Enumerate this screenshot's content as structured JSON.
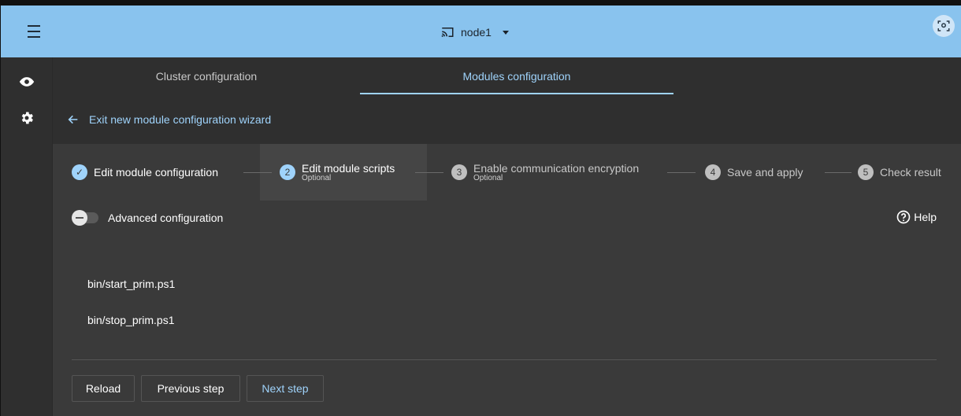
{
  "header": {
    "node_label": "node1",
    "accent_color": "#89c3ee"
  },
  "icons": {
    "menu": "hamburger-menu-icon",
    "cast": "cast-icon",
    "face": "face-scan-icon",
    "eye": "eye-icon",
    "gear": "gear-icon",
    "back": "arrow-left-icon",
    "help": "question-circle-icon"
  },
  "tabs": [
    {
      "label": "Cluster configuration",
      "active": false
    },
    {
      "label": "Modules configuration",
      "active": true
    }
  ],
  "exit_wizard_label": "Exit new module configuration wizard",
  "steps": [
    {
      "number": "✓",
      "label": "Edit module configuration",
      "sub": "",
      "state": "done"
    },
    {
      "number": "2",
      "label": "Edit module scripts",
      "sub": "Optional",
      "state": "active"
    },
    {
      "number": "3",
      "label": "Enable communication encryption",
      "sub": "Optional",
      "state": "todo"
    },
    {
      "number": "4",
      "label": "Save and apply",
      "sub": "",
      "state": "todo"
    },
    {
      "number": "5",
      "label": "Check result",
      "sub": "",
      "state": "todo"
    }
  ],
  "advanced": {
    "label": "Advanced configuration",
    "enabled": false
  },
  "help_label": "Help",
  "scripts": [
    "bin/start_prim.ps1",
    "bin/stop_prim.ps1"
  ],
  "buttons": {
    "reload": "Reload",
    "previous": "Previous step",
    "next": "Next step"
  }
}
